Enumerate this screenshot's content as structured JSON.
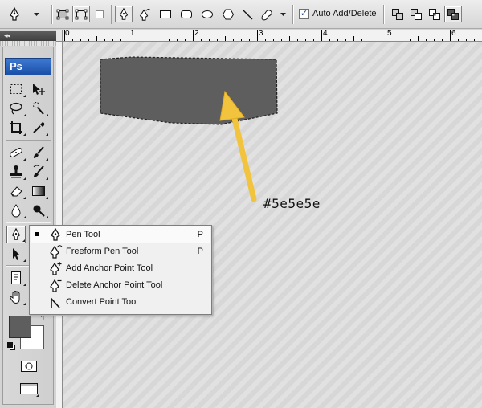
{
  "options_bar": {
    "auto_add_delete_label": "Auto Add/Delete",
    "auto_add_delete_checked": true,
    "check_mark": "✓"
  },
  "ruler": {
    "ticks": [
      "0",
      "1",
      "2",
      "3",
      "4",
      "5",
      "6"
    ]
  },
  "tools_panel": {
    "collapse_glyph": "◂◂",
    "logo_text": "Ps"
  },
  "colors": {
    "foreground": "#5e5e5e",
    "background": "#ffffff",
    "shape_fill": "#5e5e5e",
    "annotation_arrow": "#f2c43d"
  },
  "flyout": {
    "items": [
      {
        "label": "Pen Tool",
        "key": "P",
        "selected": true,
        "icon": "pen-icon"
      },
      {
        "label": "Freeform Pen Tool",
        "key": "P",
        "selected": false,
        "icon": "freeform-pen-icon"
      },
      {
        "label": "Add Anchor Point Tool",
        "key": "",
        "selected": false,
        "icon": "add-anchor-point-icon"
      },
      {
        "label": "Delete Anchor Point Tool",
        "key": "",
        "selected": false,
        "icon": "delete-anchor-point-icon"
      },
      {
        "label": "Convert Point Tool",
        "key": "",
        "selected": false,
        "icon": "convert-point-icon"
      }
    ]
  },
  "annotation": {
    "color_label": "#5e5e5e"
  }
}
